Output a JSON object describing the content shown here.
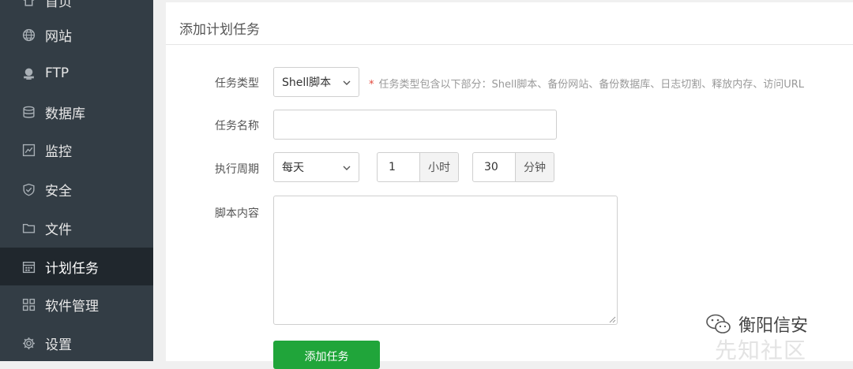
{
  "sidebar": {
    "items": [
      {
        "label": "首页",
        "icon": "home-icon"
      },
      {
        "label": "网站",
        "icon": "globe-icon"
      },
      {
        "label": "FTP",
        "icon": "ftp-icon"
      },
      {
        "label": "数据库",
        "icon": "database-icon"
      },
      {
        "label": "监控",
        "icon": "monitor-icon"
      },
      {
        "label": "安全",
        "icon": "shield-icon"
      },
      {
        "label": "文件",
        "icon": "folder-icon"
      },
      {
        "label": "计划任务",
        "icon": "calendar-icon",
        "active": true
      },
      {
        "label": "软件管理",
        "icon": "grid-icon"
      },
      {
        "label": "设置",
        "icon": "gear-icon"
      }
    ],
    "active_bg": "#20272d",
    "bg": "#333d45"
  },
  "panel": {
    "title": "添加计划任务",
    "task_type": {
      "label": "任务类型",
      "value": "Shell脚本",
      "hint_star": "*",
      "hint": "任务类型包含以下部分：Shell脚本、备份网站、备份数据库、日志切割、释放内存、访问URL"
    },
    "task_name": {
      "label": "任务名称",
      "value": ""
    },
    "cycle": {
      "label": "执行周期",
      "period": "每天",
      "hour_value": "1",
      "hour_unit": "小时",
      "minute_value": "30",
      "minute_unit": "分钟"
    },
    "script": {
      "label": "脚本内容",
      "value": ""
    },
    "submit_label": "添加任务",
    "accent": "#20a53a"
  },
  "watermark": {
    "primary": "衡阳信安",
    "secondary": "先知社区"
  }
}
